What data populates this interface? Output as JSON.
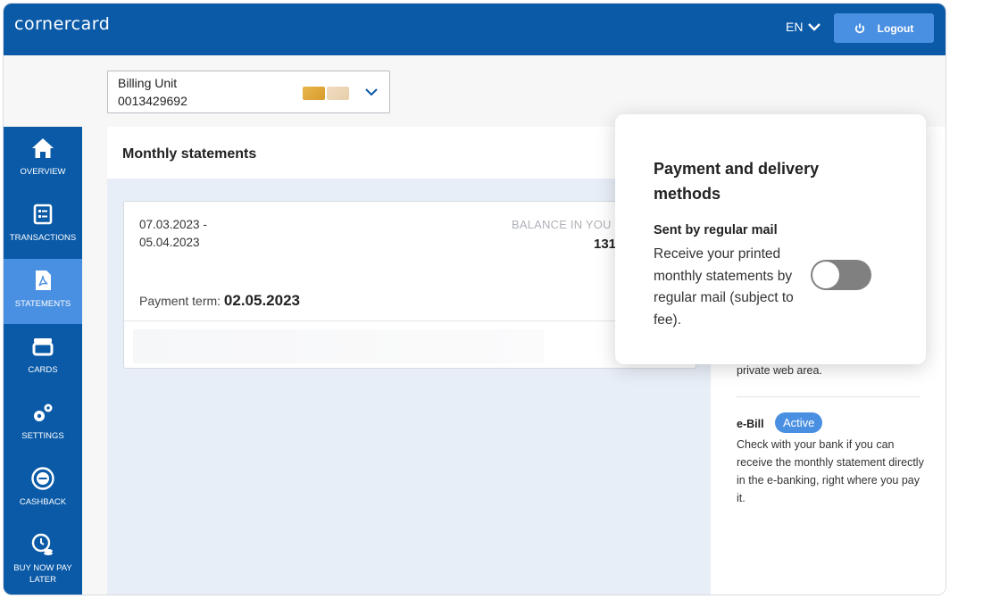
{
  "header": {
    "logo": "cornercard",
    "language": "EN",
    "logout_label": "Logout"
  },
  "billing": {
    "label": "Billing Unit",
    "number": "0013429692"
  },
  "sidebar": {
    "items": [
      {
        "label": "OVERVIEW",
        "icon": "home-icon"
      },
      {
        "label": "TRANSACTIONS",
        "icon": "transactions-icon"
      },
      {
        "label": "STATEMENTS",
        "icon": "pdf-document-icon",
        "active": true
      },
      {
        "label": "CARDS",
        "icon": "cards-icon"
      },
      {
        "label": "SETTINGS",
        "icon": "gears-icon"
      },
      {
        "label": "CASHBACK",
        "icon": "cashback-icon"
      },
      {
        "label": "BUY NOW PAY LATER",
        "icon": "clock-coins-icon"
      }
    ]
  },
  "statements": {
    "title": "Monthly statements",
    "card": {
      "period_start": "07.03.2023 -",
      "period_end": "05.04.2023",
      "balance_label": "BALANCE IN YOU",
      "balance_value": "131",
      "payment_term_label": "Payment term:",
      "payment_term_date": "02.05.2023"
    }
  },
  "right": {
    "private_text": "private web area.",
    "ebill_title": "e-Bill",
    "ebill_badge": "Active",
    "ebill_desc": "Check with your bank if you can receive the monthly statement directly in the e-banking, right where you pay it."
  },
  "popover": {
    "title": "Payment and delivery methods",
    "subtitle": "Sent by regular mail",
    "description": "Receive your printed monthly statements by regular mail (subject to fee).",
    "toggle_on": false
  },
  "colors": {
    "brand_blue": "#0a5aa8",
    "accent_blue": "#4a90e2",
    "toggle_off": "#808080"
  }
}
